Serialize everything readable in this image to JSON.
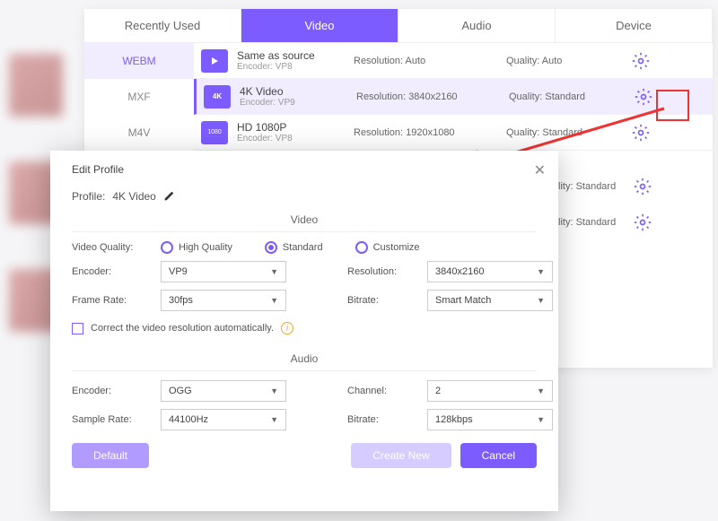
{
  "tabs": [
    "Recently Used",
    "Video",
    "Audio",
    "Device"
  ],
  "activeTab": 1,
  "sidebar": {
    "items": [
      "WEBM",
      "MXF",
      "M4V"
    ],
    "active": 0
  },
  "formats": [
    {
      "icon": "▶",
      "title": "Same as source",
      "encoder": "Encoder: VP8",
      "res_label": "Resolution:",
      "res_val": "Auto",
      "qual_label": "Quality:",
      "qual_val": "Auto"
    },
    {
      "icon": "4K",
      "title": "4K Video",
      "encoder": "Encoder: VP9",
      "res_label": "Resolution:",
      "res_val": "3840x2160",
      "qual_label": "Quality:",
      "qual_val": "Standard",
      "selected": true
    },
    {
      "icon": "1080",
      "title": "HD 1080P",
      "encoder": "Encoder: VP8",
      "res_label": "Resolution:",
      "res_val": "1920x1080",
      "qual_label": "Quality:",
      "qual_val": "Standard"
    }
  ],
  "extraRows": [
    {
      "qual_label": "lity:",
      "qual_val": "Standard"
    },
    {
      "qual_label": "lity:",
      "qual_val": "Standard"
    }
  ],
  "modal": {
    "title": "Edit Profile",
    "profile_label": "Profile:",
    "profile_value": "4K Video",
    "video_section": "Video",
    "audio_section": "Audio",
    "quality_label": "Video Quality:",
    "radios": [
      "High Quality",
      "Standard",
      "Customize"
    ],
    "radio_checked": 1,
    "encoder_label": "Encoder:",
    "encoder_value": "VP9",
    "resolution_label": "Resolution:",
    "resolution_value": "3840x2160",
    "framerate_label": "Frame Rate:",
    "framerate_value": "30fps",
    "bitrate_label": "Bitrate:",
    "bitrate_value": "Smart Match",
    "checkbox_label": "Correct the video resolution automatically.",
    "audio_encoder_label": "Encoder:",
    "audio_encoder_value": "OGG",
    "channel_label": "Channel:",
    "channel_value": "2",
    "samplerate_label": "Sample Rate:",
    "samplerate_value": "44100Hz",
    "audio_bitrate_label": "Bitrate:",
    "audio_bitrate_value": "128kbps",
    "btn_default": "Default",
    "btn_create": "Create New",
    "btn_cancel": "Cancel"
  }
}
